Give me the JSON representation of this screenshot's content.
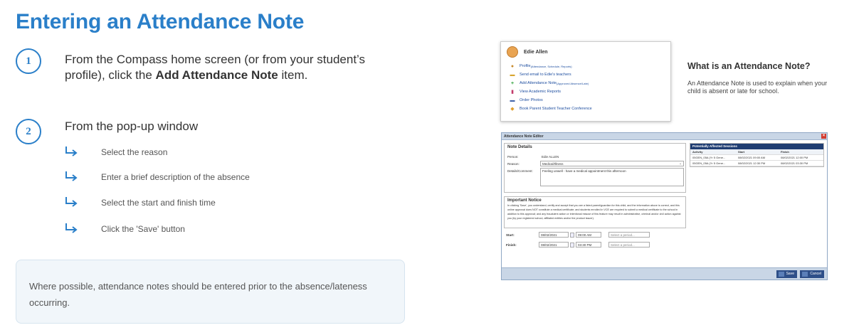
{
  "title": "Entering an Attendance Note",
  "steps": [
    {
      "num": "1",
      "text_before": "From the Compass home screen (or from your student’s profile), click the ",
      "bold": "Add Attendance Note",
      "text_after": " item."
    },
    {
      "num": "2",
      "text": "From the pop-up window"
    }
  ],
  "substeps": [
    "Select the reason",
    "Enter a brief description of the absence",
    "Select the start and finish time",
    "Click the 'Save' button"
  ],
  "note": "Where possible, attendance notes should be entered prior to the absence/lateness occurring.",
  "menu": {
    "user_name": "Edie Allen",
    "items": [
      {
        "label": "Profile",
        "sub": " (Attendance, Schedule, Reports)",
        "icon": "person-icon"
      },
      {
        "label": "Send email to Edie's teachers",
        "sub": "",
        "icon": "email-icon"
      },
      {
        "label": "Add Attendance Note",
        "sub": " (Approved Absence/Late)",
        "icon": "plus-icon"
      },
      {
        "label": "View Academic Reports",
        "sub": "",
        "icon": "report-icon"
      },
      {
        "label": "Order Photos",
        "sub": "",
        "icon": "photo-icon"
      },
      {
        "label": "Book Parent Student Teacher Conference",
        "sub": "",
        "icon": "conference-icon"
      }
    ]
  },
  "what_is": {
    "title": "What is an Attendance Note?",
    "body": "An Attendance Note is used to explain when your child is absent or late for school."
  },
  "editor": {
    "title": "Attendance Note Editor",
    "note_details": "Note Details",
    "person_label": "Person:",
    "person_value": "Edie ALLEN",
    "reason_label": "Reason:",
    "reason_value": "Medical/Illness",
    "details_label": "Details/Comment:",
    "details_value": "Feeling unwell - have a medical appointment this afternoon",
    "important_notice": "Important Notice",
    "notice_text": "In clicking 'Save', you understand, certify and accept that you are a listed parent/guardian for this child, and the information above is correct, and this online approval does NOT constitute a medical certificate; and students enrolled in VCE are required to submit a medical certificate to the school in addition to this approval; and any fraudulent action or intentional misuse of this feature may result in administrative, criminal and/or civil action against you (by your registered school, affiliated entities and/or the product issuer).",
    "start_label": "Start:",
    "start_date": "08/02/2021",
    "start_time": "09:00 AM",
    "finish_label": "Finish:",
    "finish_date": "08/02/2021",
    "finish_time": "03:30 PM",
    "period_placeholder": "Select a period...",
    "sessions_title": "Potentially Affected Sessions",
    "sessions_cols": [
      "Activity",
      "Start",
      "Finish"
    ],
    "sessions_rows": [
      [
        "05GEN_05A (Yr 5 Gene...",
        "08/02/2021 09:00 AM",
        "08/02/2021 12:00 PM"
      ],
      [
        "05GEN_05A (Yr 5 Gene...",
        "08/02/2021 12:30 PM",
        "08/02/2021 03:30 PM"
      ]
    ],
    "save": "Save",
    "cancel": "Cancel"
  },
  "colors": {
    "accent": "#2a7fc9",
    "editor_header": "#c9d6e6",
    "table_header": "#1f3d72"
  }
}
